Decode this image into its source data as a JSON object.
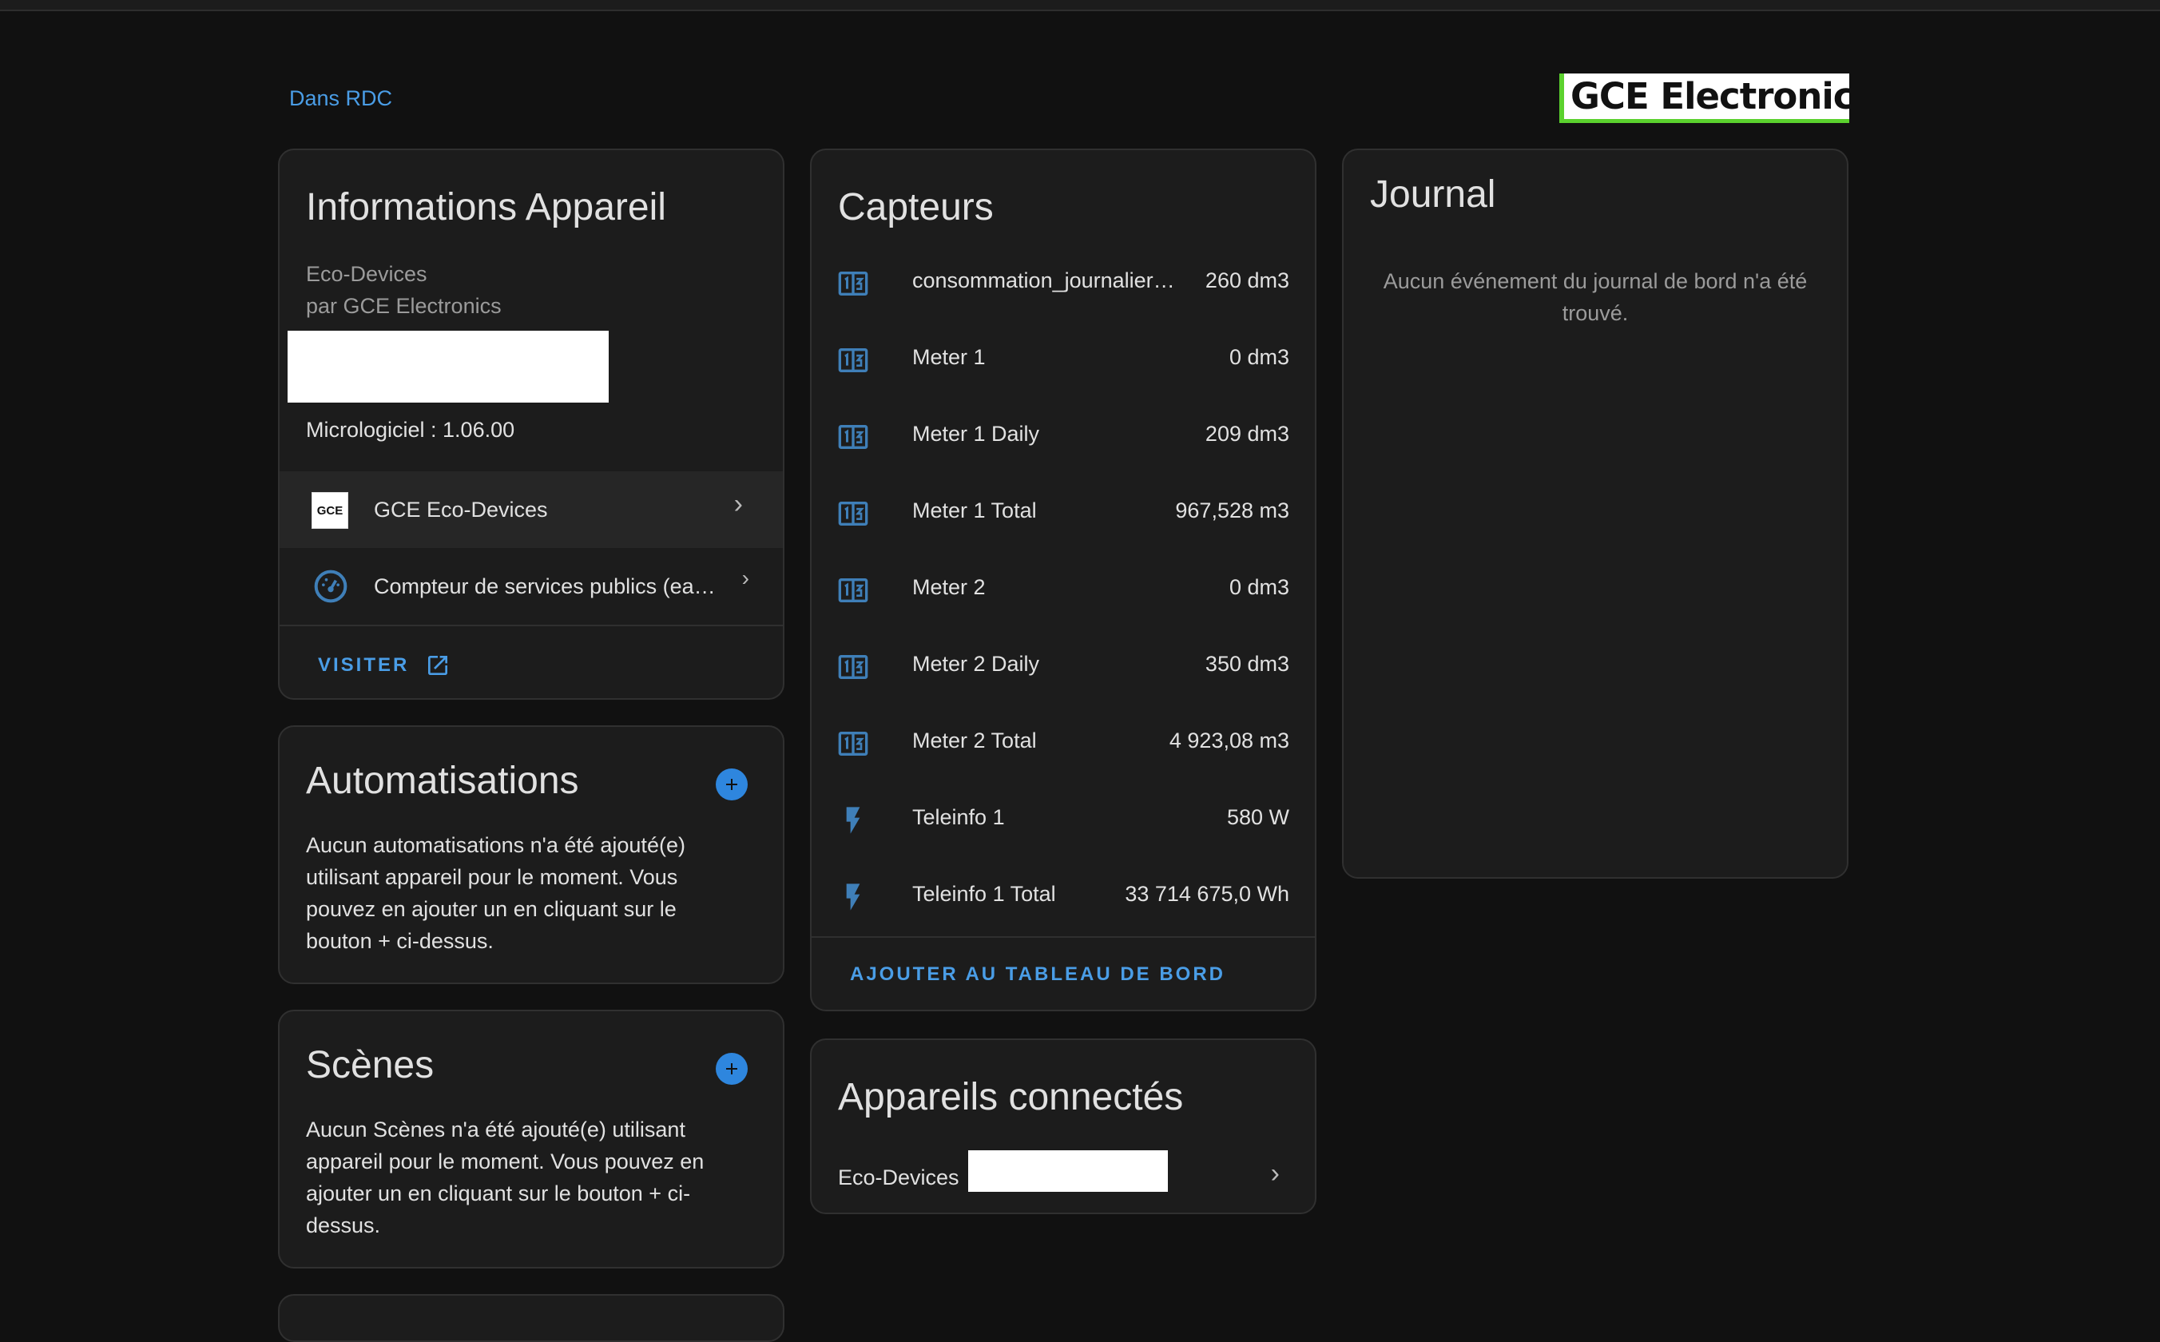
{
  "breadcrumb": "Dans RDC",
  "brand_logo_text": "GCE Electronics",
  "device_info": {
    "title": "Informations Appareil",
    "model": "Eco-Devices",
    "manufacturer": "par GCE Electronics",
    "firmware": "Micrologiciel : 1.06.00",
    "integration_label": "GCE Eco-Devices",
    "integration_icon_text": "GCE",
    "service_label": "Compteur de services publics (ea…",
    "visit_label": "VISITER"
  },
  "automations": {
    "title": "Automatisations",
    "empty_text": "Aucun automatisations n'a été ajouté(e) utilisant appareil pour le moment. Vous pouvez en ajouter un en cliquant sur le bouton + ci-dessus."
  },
  "scenes": {
    "title": "Scènes",
    "empty_text": "Aucun Scènes n'a été ajouté(e) utilisant appareil pour le moment. Vous pouvez en ajouter un en cliquant sur le bouton + ci-dessus."
  },
  "sensors": {
    "title": "Capteurs",
    "items": [
      {
        "name": "consommation_journalier…",
        "value": "260 dm3",
        "icon": "counter-icon"
      },
      {
        "name": "Meter 1",
        "value": "0 dm3",
        "icon": "counter-icon"
      },
      {
        "name": "Meter 1 Daily",
        "value": "209 dm3",
        "icon": "counter-icon"
      },
      {
        "name": "Meter 1 Total",
        "value": "967,528 m3",
        "icon": "counter-icon"
      },
      {
        "name": "Meter 2",
        "value": "0 dm3",
        "icon": "counter-icon"
      },
      {
        "name": "Meter 2 Daily",
        "value": "350 dm3",
        "icon": "counter-icon"
      },
      {
        "name": "Meter 2 Total",
        "value": "4 923,08 m3",
        "icon": "counter-icon"
      },
      {
        "name": "Teleinfo 1",
        "value": "580 W",
        "icon": "flash-icon"
      },
      {
        "name": "Teleinfo 1 Total",
        "value": "33 714 675,0 Wh",
        "icon": "flash-icon"
      }
    ],
    "add_to_dashboard_label": "AJOUTER AU TABLEAU DE BORD"
  },
  "connected": {
    "title": "Appareils connectés",
    "device_label": "Eco-Devices"
  },
  "journal": {
    "title": "Journal",
    "empty_text": "Aucun événement du journal de bord n'a été trouvé."
  },
  "colors": {
    "background": "#111111",
    "card": "#1c1c1c",
    "accent": "#4a9de6",
    "icon_blue": "#3f7fb8",
    "logo_green": "#5bd12e"
  }
}
